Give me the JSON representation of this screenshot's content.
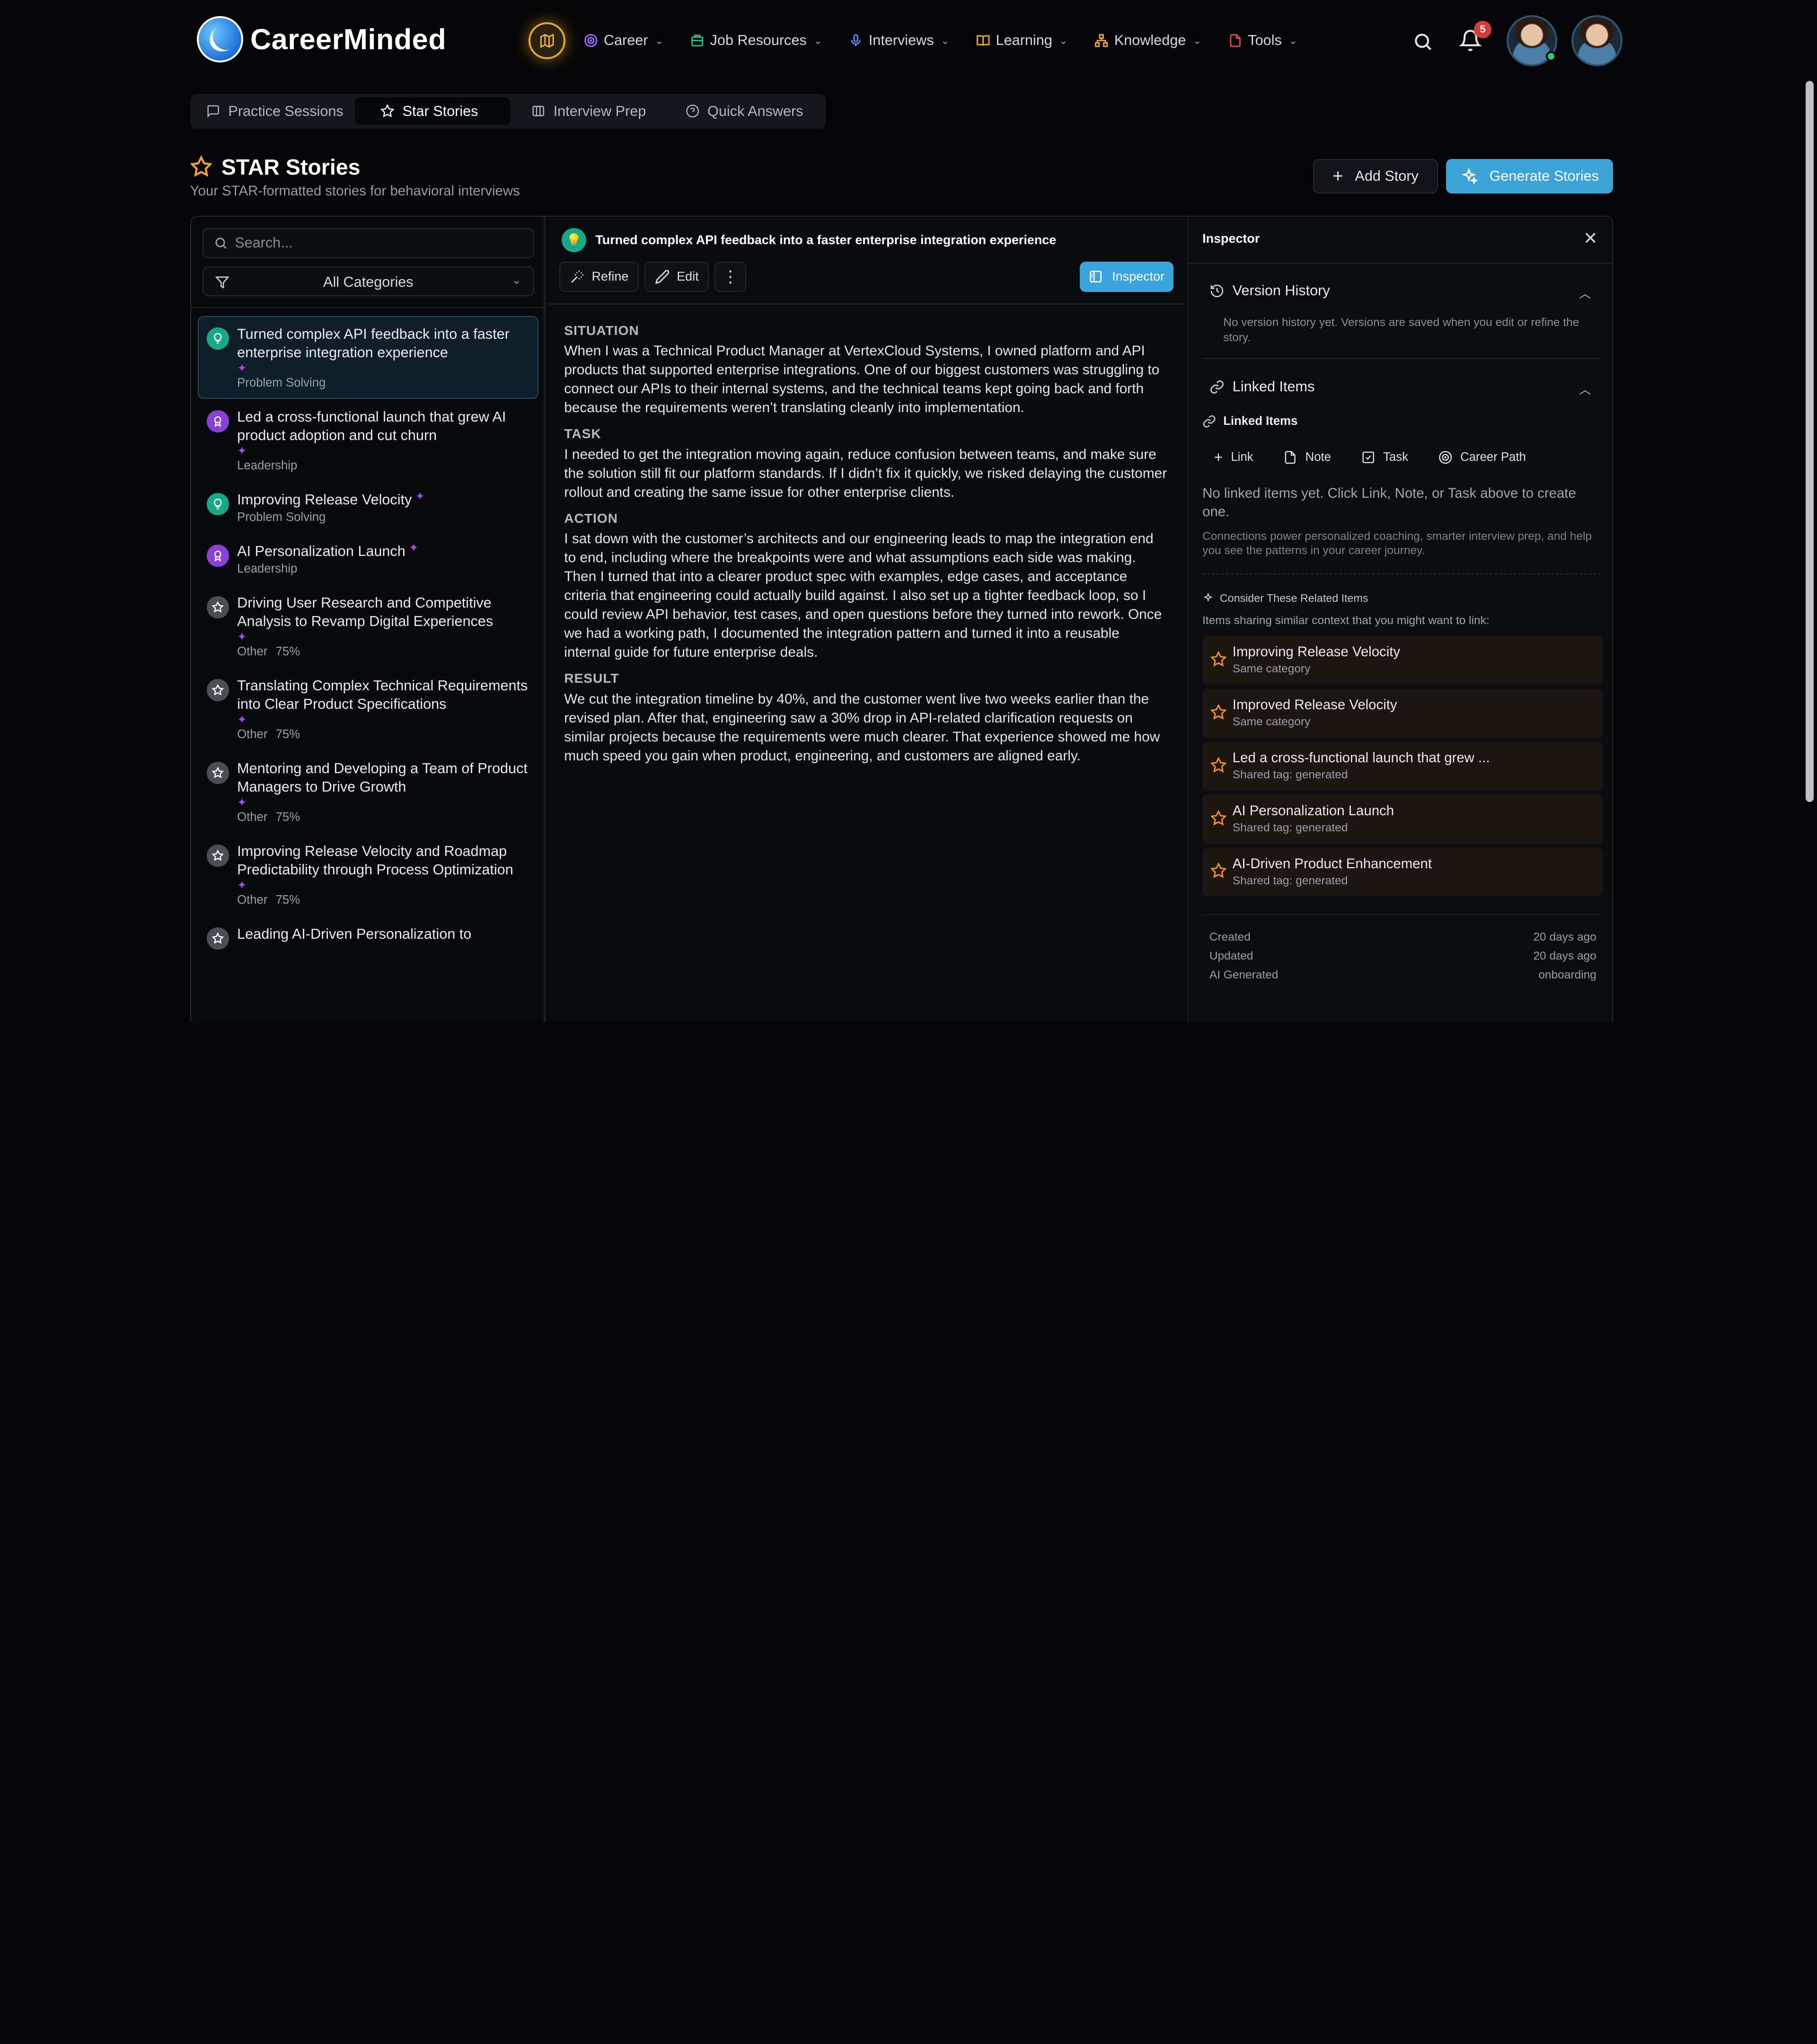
{
  "brand": {
    "name": "CareerMinded"
  },
  "nav": {
    "items": [
      {
        "label": "Career",
        "icon": "target-icon",
        "color": "#a56bff"
      },
      {
        "label": "Job Resources",
        "icon": "building-icon",
        "color": "#2dbf8f"
      },
      {
        "label": "Interviews",
        "icon": "microphone-icon",
        "color": "#5a8cff"
      },
      {
        "label": "Learning",
        "icon": "book-icon",
        "color": "#f0a23a"
      },
      {
        "label": "Knowledge",
        "icon": "network-icon",
        "color": "#f0a23a"
      },
      {
        "label": "Tools",
        "icon": "file-icon",
        "color": "#e0435a"
      }
    ],
    "notifications": "5"
  },
  "subtabs": [
    {
      "label": "Practice Sessions"
    },
    {
      "label": "Star Stories"
    },
    {
      "label": "Interview Prep"
    },
    {
      "label": "Quick Answers"
    }
  ],
  "header": {
    "title": "STAR Stories",
    "subtitle": "Your STAR-formatted stories for behavioral interviews",
    "add_label": "Add Story",
    "generate_label": "Generate Stories"
  },
  "sidebar": {
    "search_placeholder": "Search...",
    "filter_label": "All Categories",
    "stories": [
      {
        "title": "Turned complex API feedback into a faster enterprise integration experience",
        "category": "Problem Solving",
        "percent": "",
        "icon": "lightbulb-icon",
        "color": "green",
        "sparkle_inline": false
      },
      {
        "title": "Led a cross-functional launch that grew AI product adoption and cut churn",
        "category": "Leadership",
        "percent": "",
        "icon": "award-icon",
        "color": "purple",
        "sparkle_inline": false
      },
      {
        "title": "Improving Release Velocity",
        "category": "Problem Solving",
        "percent": "",
        "icon": "lightbulb-icon",
        "color": "green",
        "sparkle_inline": true
      },
      {
        "title": "AI Personalization Launch",
        "category": "Leadership",
        "percent": "",
        "icon": "award-icon",
        "color": "purple",
        "sparkle_inline": true
      },
      {
        "title": "Driving User Research and Competitive Analysis to Revamp Digital Experiences",
        "category": "Other",
        "percent": "75%",
        "icon": "star-icon",
        "color": "gray",
        "sparkle_inline": false
      },
      {
        "title": "Translating Complex Technical Requirements into Clear Product Specifications",
        "category": "Other",
        "percent": "75%",
        "icon": "star-icon",
        "color": "gray",
        "sparkle_inline": false
      },
      {
        "title": "Mentoring and Developing a Team of Product Managers to Drive Growth",
        "category": "Other",
        "percent": "75%",
        "icon": "star-icon",
        "color": "gray",
        "sparkle_inline": false
      },
      {
        "title": "Improving Release Velocity and Roadmap Predictability through Process Optimization",
        "category": "Other",
        "percent": "75%",
        "icon": "star-icon",
        "color": "gray",
        "sparkle_inline": false
      },
      {
        "title": "Leading AI-Driven Personalization to",
        "category": "",
        "percent": "",
        "icon": "star-icon",
        "color": "gray",
        "sparkle_inline": false
      }
    ]
  },
  "story": {
    "title": "Turned complex API feedback into a faster enterprise integration experience",
    "refine_label": "Refine",
    "edit_label": "Edit",
    "inspector_label": "Inspector",
    "sections": [
      {
        "heading": "SITUATION",
        "text": "When I was a Technical Product Manager at VertexCloud Systems, I owned platform and API products that supported enterprise integrations. One of our biggest customers was struggling to connect our APIs to their internal systems, and the technical teams kept going back and forth because the requirements weren’t translating cleanly into implementation."
      },
      {
        "heading": "TASK",
        "text": "I needed to get the integration moving again, reduce confusion between teams, and make sure the solution still fit our platform standards. If I didn’t fix it quickly, we risked delaying the customer rollout and creating the same issue for other enterprise clients."
      },
      {
        "heading": "ACTION",
        "text": "I sat down with the customer’s architects and our engineering leads to map the integration end to end, including where the breakpoints were and what assumptions each side was making. Then I turned that into a clearer product spec with examples, edge cases, and acceptance criteria that engineering could actually build against. I also set up a tighter feedback loop, so I could review API behavior, test cases, and open questions before they turned into rework. Once we had a working path, I documented the integration pattern and turned it into a reusable internal guide for future enterprise deals."
      },
      {
        "heading": "RESULT",
        "text": "We cut the integration timeline by 40%, and the customer went live two weeks earlier than the revised plan. After that, engineering saw a 30% drop in API-related clarification requests on similar projects because the requirements were much clearer. That experience showed me how much speed you gain when product, engineering, and customers are aligned early."
      }
    ]
  },
  "inspector": {
    "title": "Inspector",
    "version_history": {
      "heading": "Version History",
      "empty": "No version history yet. Versions are saved when you edit or refine the story."
    },
    "linked": {
      "heading": "Linked Items",
      "sublabel": "Linked Items",
      "actions": [
        {
          "label": "Link",
          "icon": "plus-icon"
        },
        {
          "label": "Note",
          "icon": "note-icon"
        },
        {
          "label": "Task",
          "icon": "checkbox-icon"
        },
        {
          "label": "Career Path",
          "icon": "target-icon"
        }
      ],
      "empty": "No linked items yet. Click Link, Note, or Task above to create one.",
      "note": "Connections power personalized coaching, smarter interview prep, and help you see the patterns in your career journey."
    },
    "related": {
      "heading": "Consider These Related Items",
      "subheading": "Items sharing similar context that you might want to link:",
      "items": [
        {
          "title": "Improving Release Velocity",
          "reason": "Same category"
        },
        {
          "title": "Improved Release Velocity",
          "reason": "Same category"
        },
        {
          "title": "Led a cross-functional launch that grew ...",
          "reason": "Shared tag: generated"
        },
        {
          "title": "AI Personalization Launch",
          "reason": "Shared tag: generated"
        },
        {
          "title": "AI-Driven Product Enhancement",
          "reason": "Shared tag: generated"
        }
      ]
    },
    "meta": [
      {
        "label": "Created",
        "value": "20 days ago"
      },
      {
        "label": "Updated",
        "value": "20 days ago"
      },
      {
        "label": "AI Generated",
        "value": "onboarding"
      }
    ]
  }
}
